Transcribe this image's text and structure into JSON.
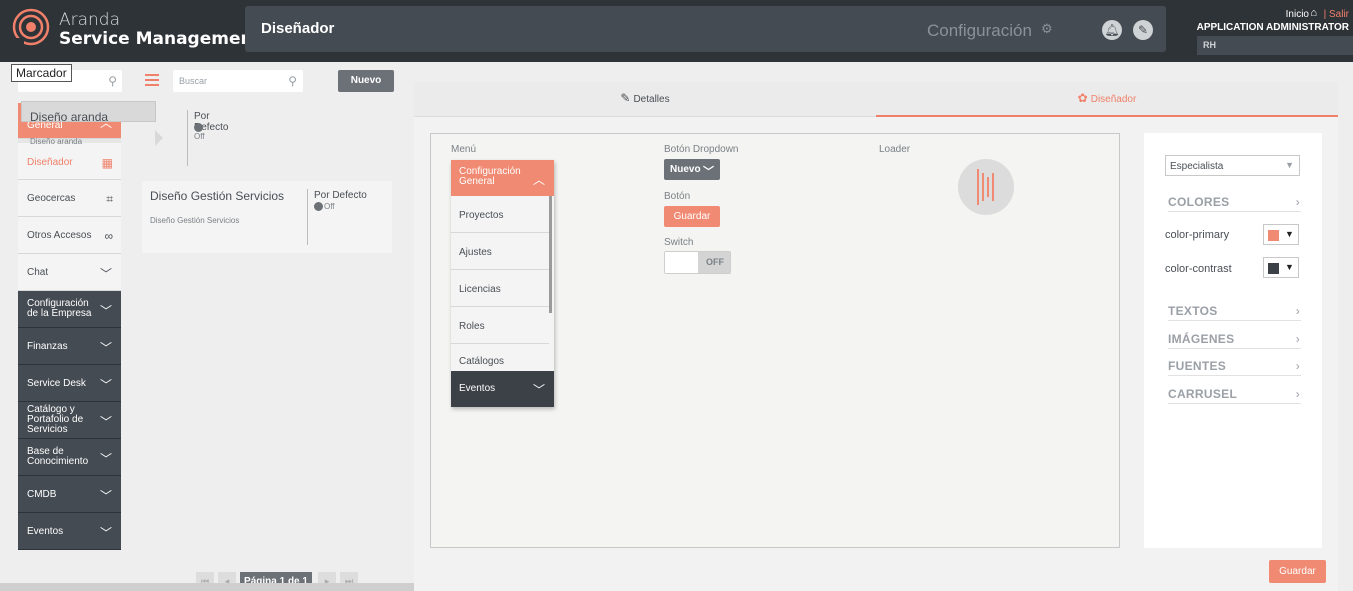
{
  "header": {
    "brand_line1": "Aranda",
    "brand_line2": "Service Management",
    "page_title": "Diseñador",
    "config_label": "Configuración",
    "inicio": "Inicio",
    "salir": "| Salir",
    "user_name": "APPLICATION ADMINISTRATOR",
    "user_initials": "RH"
  },
  "tooltip": "Marcador",
  "sidebar": {
    "items": [
      {
        "label": "Configuración General",
        "style": "orange",
        "icon": "chevron-up-icon"
      },
      {
        "label": "Diseñador",
        "style": "light-active",
        "icon": "layout-icon"
      },
      {
        "label": "Geocercas",
        "style": "light",
        "icon": "network-icon"
      },
      {
        "label": "Otros Accesos",
        "style": "light",
        "icon": "link-icon"
      },
      {
        "label": "Chat",
        "style": "light",
        "icon": "chevron-down-icon"
      },
      {
        "label": "Configuración de la Empresa",
        "style": "dark",
        "icon": "chevron-down-icon"
      },
      {
        "label": "Finanzas",
        "style": "dark",
        "icon": "chevron-down-icon"
      },
      {
        "label": "Service Desk",
        "style": "dark",
        "icon": "chevron-down-icon"
      },
      {
        "label": "Catálogo y Portafolio de Servicios",
        "style": "dark",
        "icon": "chevron-down-icon"
      },
      {
        "label": "Base de Conocimiento",
        "style": "dark",
        "icon": "chevron-down-icon"
      },
      {
        "label": "CMDB",
        "style": "dark",
        "icon": "chevron-down-icon"
      },
      {
        "label": "Eventos",
        "style": "dark",
        "icon": "chevron-down-icon"
      }
    ]
  },
  "list": {
    "search_placeholder": "Buscar",
    "new_button": "Nuevo",
    "cards": [
      {
        "name": "Diseño aranda",
        "sub": "Diseño aranda",
        "default_label": "Por Defecto",
        "state": "Off",
        "selected": true
      },
      {
        "name": "Diseño Gestión Servicios",
        "sub": "Diseño Gestión Servicios",
        "default_label": "Por Defecto",
        "state": "Off",
        "selected": false
      }
    ],
    "pager": "Página 1 de 1"
  },
  "tabs": [
    {
      "label": "Detalles",
      "icon": "edit-icon",
      "active": false
    },
    {
      "label": "Diseñador",
      "icon": "palette-icon",
      "active": true
    }
  ],
  "preview": {
    "menu_label": "Menú",
    "menu_head": "Configuración General",
    "menu_items": [
      "Proyectos",
      "Ajustes",
      "Licencias",
      "Roles",
      "Catálogos"
    ],
    "menu_foot": "Eventos",
    "dropdown_label": "Botón Dropdown",
    "dropdown_value": "Nuevo",
    "button_label": "Botón",
    "button_value": "Guardar",
    "switch_label": "Switch",
    "switch_value": "OFF",
    "loader_label": "Loader"
  },
  "settings": {
    "profile_select": "Especialista",
    "sections": [
      "COLORES",
      "TEXTOS",
      "IMÁGENES",
      "FUENTES",
      "CARRUSEL"
    ],
    "colors": [
      {
        "name": "color-primary",
        "value": "#f08a72"
      },
      {
        "name": "color-contrast",
        "value": "#3b4147"
      }
    ],
    "save_button": "Guardar"
  },
  "theme": {
    "accent": "#f08a72",
    "dark": "#2e3338",
    "panel": "#454b52"
  }
}
